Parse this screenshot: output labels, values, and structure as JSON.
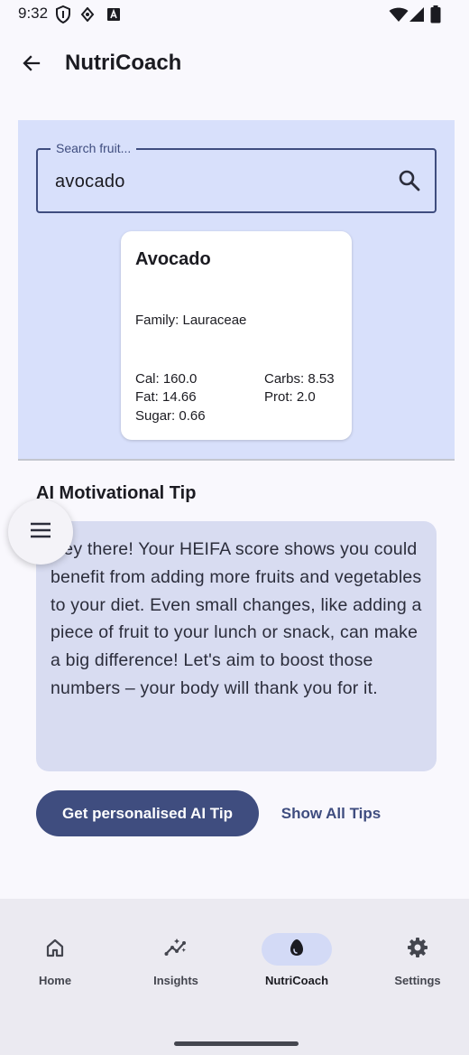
{
  "status_bar": {
    "time": "9:32",
    "icons": [
      "shield-icon",
      "data-saver-icon",
      "font-icon",
      "wifi-icon",
      "signal-icon",
      "battery-icon"
    ]
  },
  "top_bar": {
    "back_icon": "arrow-back-icon",
    "title": "NutriCoach"
  },
  "search": {
    "label": "Search fruit...",
    "value": "avocado",
    "icon": "search-icon"
  },
  "fruit_card": {
    "name": "Avocado",
    "family": "Family: Lauraceae",
    "nutrients": {
      "cal": "Cal: 160.0",
      "fat": "Fat: 14.66",
      "sugar": "Sugar: 0.66",
      "carbs": "Carbs: 8.53",
      "prot": "Prot: 2.0"
    }
  },
  "tip": {
    "heading": "AI Motivational Tip",
    "text": "Hey there!  Your HEIFA score shows you could benefit from adding more fruits and vegetables to your diet.  Even small changes, like adding a piece of fruit to your lunch or snack, can make a big difference! Let's aim to boost those numbers – your body will thank you for it."
  },
  "fab": {
    "icon": "menu-icon"
  },
  "actions": {
    "primary_label": "Get personalised AI Tip",
    "secondary_label": "Show All Tips"
  },
  "bottom_nav": {
    "items": [
      {
        "label": "Home",
        "icon": "home-icon",
        "active": false
      },
      {
        "label": "Insights",
        "icon": "insights-icon",
        "active": false
      },
      {
        "label": "NutriCoach",
        "icon": "nutricoach-icon",
        "active": true
      },
      {
        "label": "Settings",
        "icon": "settings-icon",
        "active": false
      }
    ]
  },
  "colors": {
    "primary": "#3f4d7f",
    "panel_bg": "#d8e0fb",
    "tip_card_bg": "#d8dcf1",
    "nav_bg": "#ebeaf1",
    "nav_active_pill": "#d3daf6"
  }
}
